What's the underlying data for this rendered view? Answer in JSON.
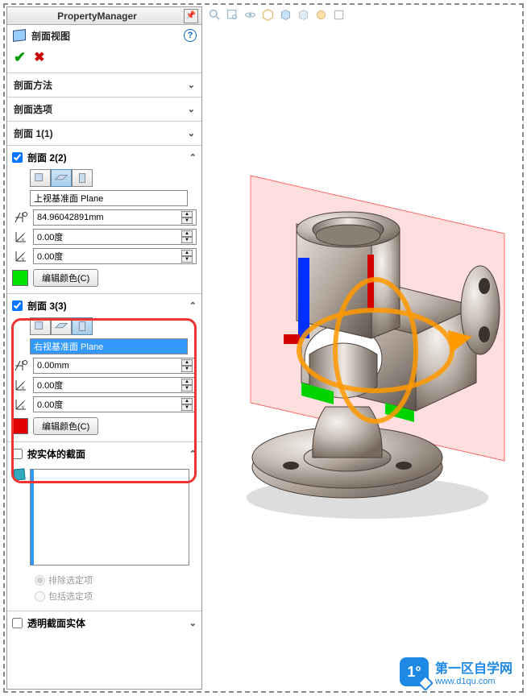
{
  "header": {
    "title": "PropertyManager"
  },
  "feature": {
    "title": "剖面视图"
  },
  "accordions": {
    "method": {
      "label": "剖面方法"
    },
    "options": {
      "label": "剖面选项"
    },
    "section1": {
      "label": "剖面 1(1)"
    }
  },
  "section2": {
    "label": "剖面 2(2)",
    "plane": "上视基准面 Plane",
    "offset": "84.96042891mm",
    "angle1": "0.00度",
    "angle2": "0.00度",
    "color": "#00e300",
    "edit_btn": "编辑颜色(C)"
  },
  "section3": {
    "label": "剖面 3(3)",
    "plane": "右视基准面 Plane",
    "offset": "0.00mm",
    "angle1": "0.00度",
    "angle2": "0.00度",
    "color": "#e30000",
    "edit_btn": "编辑颜色(C)"
  },
  "solid_section": {
    "label": "按实体的截面",
    "radio_exclude": "排除选定项",
    "radio_include": "包括选定项"
  },
  "transparent": {
    "label": "透明截面实体"
  },
  "watermark": {
    "name": "第一区自学网",
    "url": "www.d1qu.com"
  }
}
